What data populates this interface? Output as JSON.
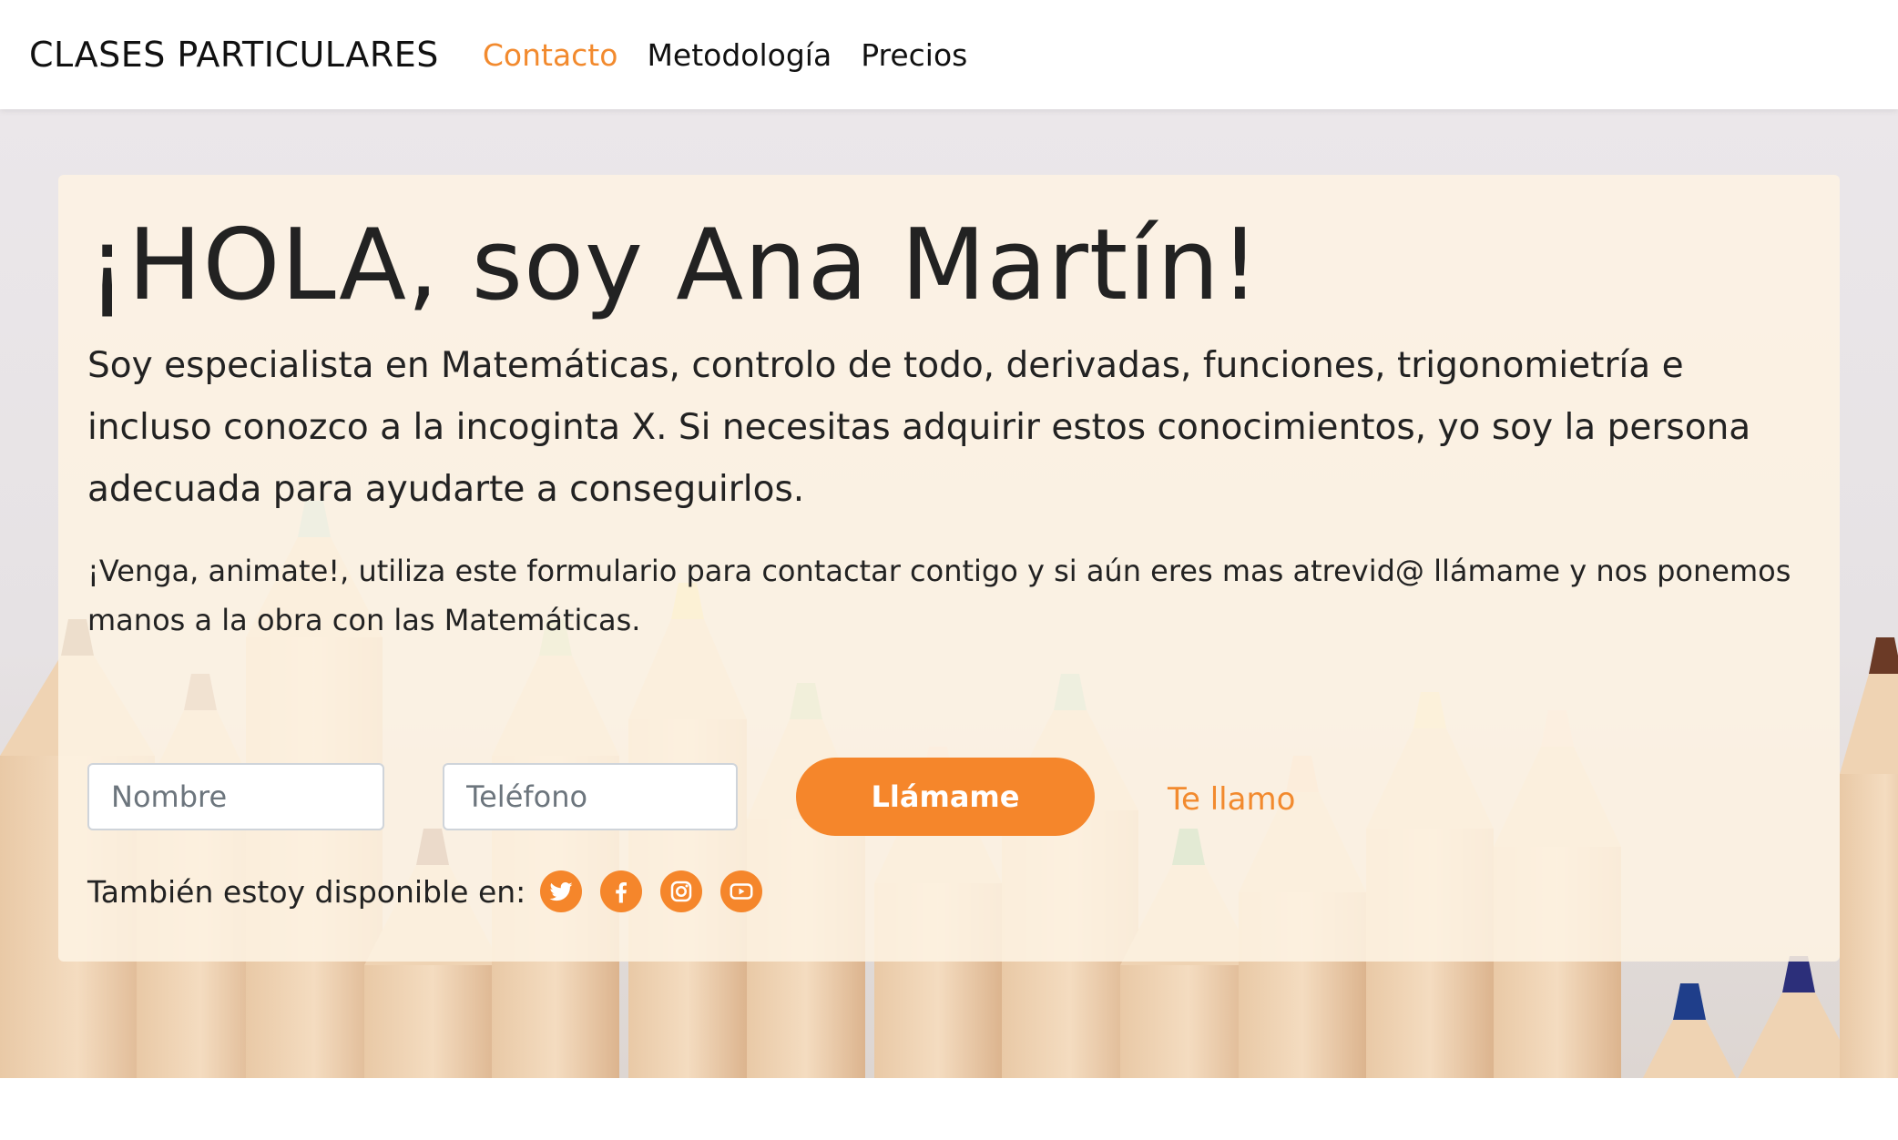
{
  "nav": {
    "brand": "CLASES PARTICULARES",
    "links": [
      "Contacto",
      "Metodología",
      "Precios"
    ],
    "active_color": "#f28a2e"
  },
  "hero": {
    "title": "¡HOLA, soy Ana Martín!",
    "lead": "Soy especialista en Matemáticas, controlo de todo, derivadas, funciones, trigonomietría e incluso conozco a la incoginta X. Si necesitas adquirir estos conocimientos, yo soy la persona adecuada para ayudarte a conseguirlos.",
    "sub": "¡Venga, animate!, utiliza este formulario para contactar contigo y si aún eres mas atrevid@ llámame y nos ponemos manos a la obra con las Matemáticas.",
    "form": {
      "name_placeholder": "Nombre",
      "phone_placeholder": "Teléfono",
      "button_label": "Llámame",
      "link_label": "Te llamo"
    },
    "social": {
      "label": "También estoy disponible en:",
      "icons": [
        "twitter-icon",
        "facebook-icon",
        "instagram-icon",
        "youtube-icon"
      ]
    }
  },
  "colors": {
    "accent": "#f5862b",
    "card_bg": "#fdf2e2"
  }
}
